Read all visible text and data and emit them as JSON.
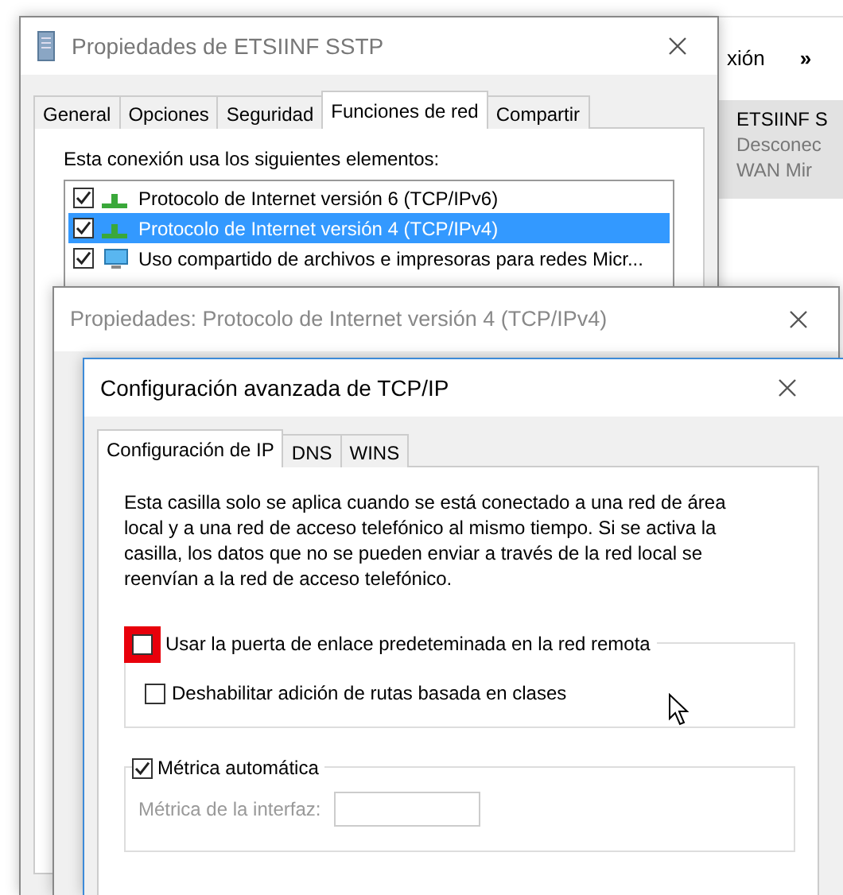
{
  "background_window": {
    "toolbar_text": "xión",
    "more": "»",
    "connection": {
      "name": "ETSIINF S",
      "status": "Desconec",
      "device": "WAN Mir"
    }
  },
  "main_window": {
    "title": "Propiedades de ETSIINF SSTP",
    "tabs": [
      {
        "label": "General",
        "selected": false
      },
      {
        "label": "Opciones",
        "selected": false
      },
      {
        "label": "Seguridad",
        "selected": false
      },
      {
        "label": "Funciones de red",
        "selected": true
      },
      {
        "label": "Compartir",
        "selected": false
      }
    ],
    "components_label": "Esta conexión usa los siguientes elementos:",
    "components": [
      {
        "label": "Protocolo de Internet versión 6 (TCP/IPv6)",
        "checked": true,
        "selected": false,
        "kind": "protocol"
      },
      {
        "label": "Protocolo de Internet versión 4 (TCP/IPv4)",
        "checked": true,
        "selected": true,
        "kind": "protocol"
      },
      {
        "label": "Uso compartido de archivos e impresoras para redes Micr...",
        "checked": true,
        "selected": false,
        "kind": "service"
      }
    ]
  },
  "ipv4_window": {
    "title": "Propiedades: Protocolo de Internet versión 4 (TCP/IPv4)"
  },
  "advanced_window": {
    "title": "Configuración avanzada de TCP/IP",
    "tabs": [
      {
        "label": "Configuración de IP",
        "selected": true
      },
      {
        "label": "DNS",
        "selected": false
      },
      {
        "label": "WINS",
        "selected": false
      }
    ],
    "description": "Esta casilla solo se aplica cuando se está conectado a una red de área local y a una red de acceso telefónico al mismo tiempo. Si se activa la casilla, los datos que no se pueden enviar a través de la red local se reenvían a la red de acceso telefónico.",
    "remote_gateway": {
      "label": "Usar la puerta de enlace predeteminada en la red remota",
      "checked": false,
      "highlighted": true
    },
    "class_routes": {
      "label": "Deshabilitar adición de rutas basada en clases",
      "checked": false
    },
    "automatic_metric": {
      "label": "Métrica automática",
      "checked": true
    },
    "interface_metric": {
      "label": "Métrica de la interfaz:",
      "disabled": true
    }
  }
}
